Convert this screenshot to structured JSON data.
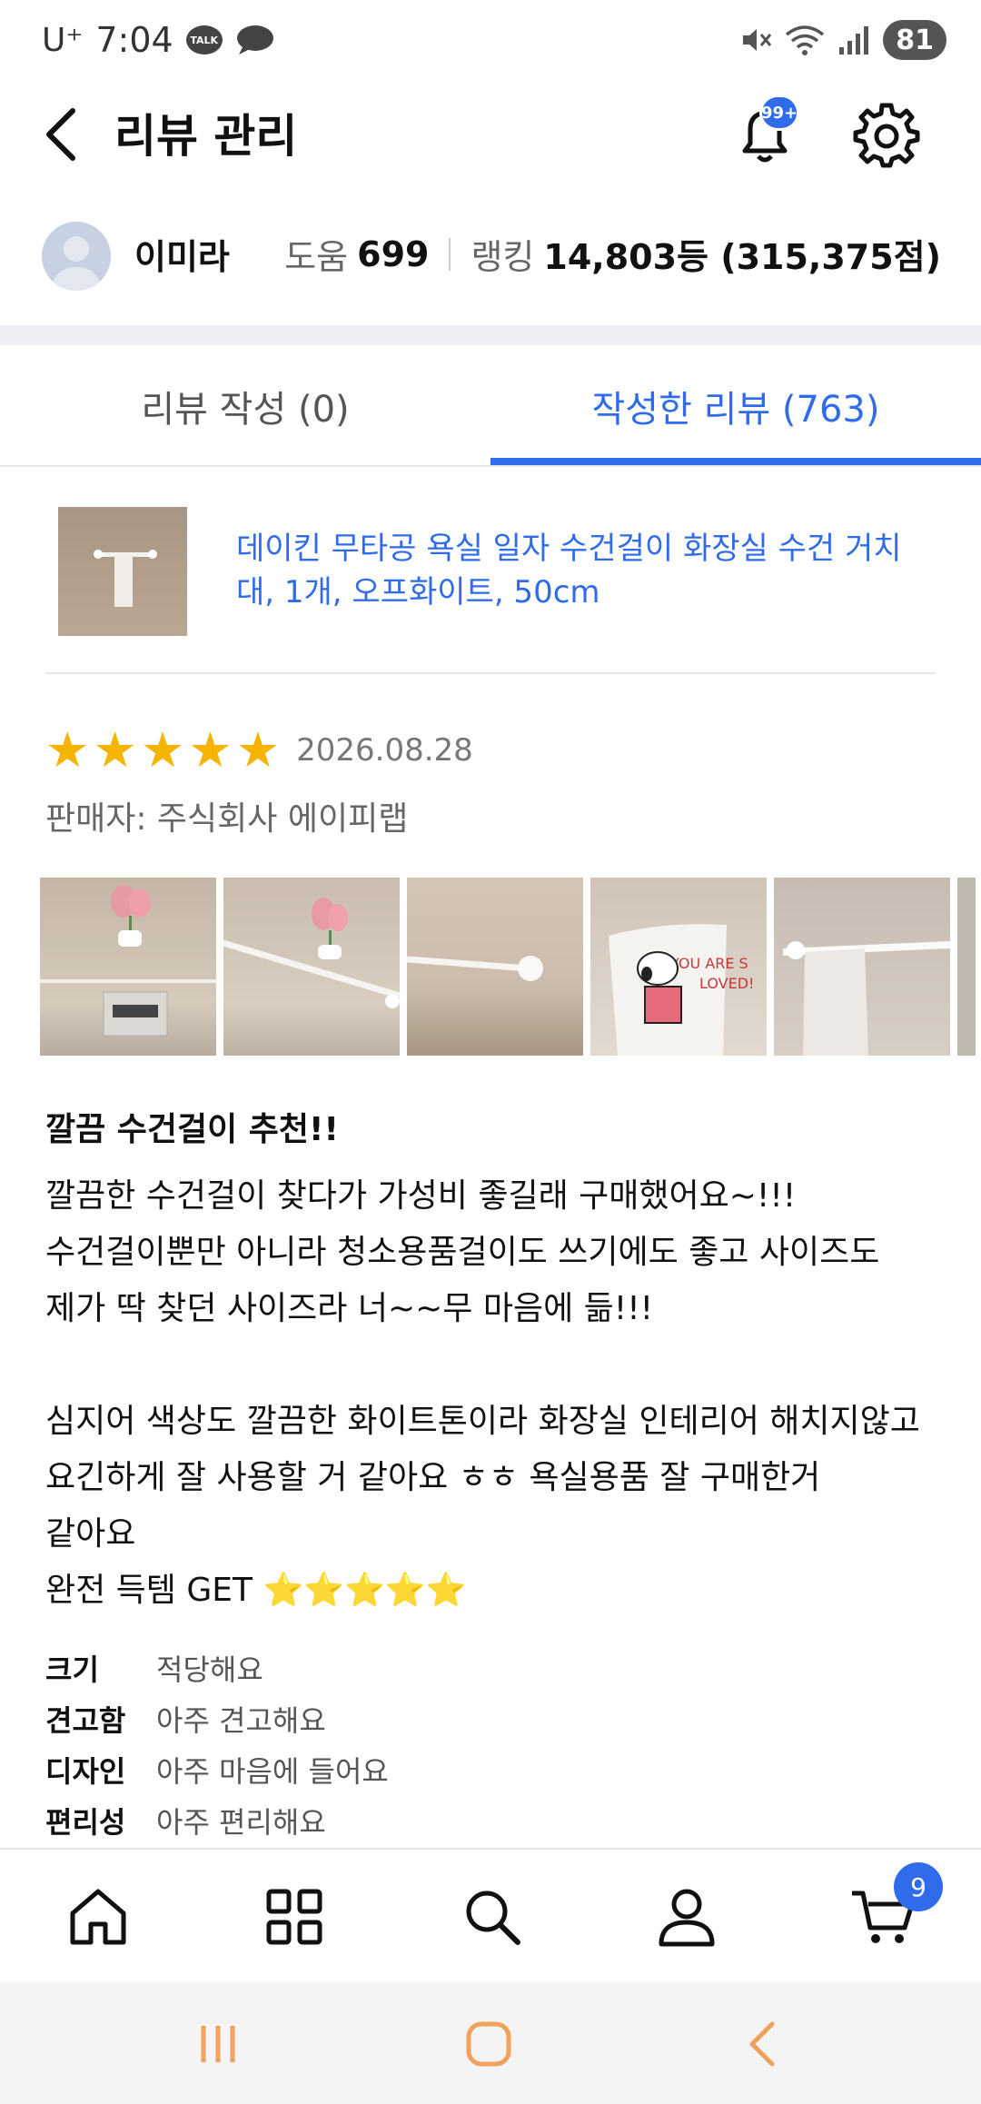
{
  "status_bar": {
    "carrier": "U⁺",
    "time": "7:04",
    "talk_icon_text": "TALK",
    "battery": "81",
    "icons": [
      "talk-icon",
      "chat-icon",
      "mute-icon",
      "wifi-icon",
      "signal-icon"
    ]
  },
  "header": {
    "title": "리뷰 관리",
    "notification_badge": "99+"
  },
  "profile": {
    "name": "이미라",
    "help_label": "도움",
    "help_value": "699",
    "ranking_label": "랭킹",
    "ranking_value": "14,803등 (315,375점)"
  },
  "tabs": [
    {
      "label": "리뷰 작성 (0)",
      "active": false
    },
    {
      "label": "작성한 리뷰 (763)",
      "active": true
    }
  ],
  "product": {
    "name": "데이킨 무타공 욕실 일자 수건걸이 화장실 수건 거치대, 1개, 오프화이트, 50cm"
  },
  "review": {
    "stars": 5,
    "date": "2026.08.28",
    "seller": "판매자: 주식회사 에이피랩",
    "photos": [
      "photo-1",
      "photo-2",
      "photo-3",
      "photo-4",
      "photo-5",
      "photo-6"
    ],
    "title": "깔끔 수건걸이 추천!!",
    "body_lines": [
      "깔끔한 수건걸이 찾다가 가성비 좋길래 구매했어요~!!!",
      "수건걸이뿐만 아니라 청소용품걸이도 쓰기에도 좋고 사이즈도",
      "제가 딱 찾던 사이즈라 너~~무 마음에 듦!!!",
      "",
      "심지어 색상도 깔끔한 화이트톤이라 화장실 인테리어 해치지않고",
      "요긴하게 잘 사용할 거 같아요 ㅎㅎ 욕실용품 잘 구매한거",
      "같아요",
      "완전 득템 GET ⭐⭐⭐⭐⭐"
    ],
    "attributes": [
      {
        "key": "크기",
        "value": "적당해요"
      },
      {
        "key": "견고함",
        "value": "아주 견고해요"
      },
      {
        "key": "디자인",
        "value": "아주 마음에 들어요"
      },
      {
        "key": "편리성",
        "value": "아주 편리해요"
      }
    ]
  },
  "bottom_nav": {
    "items": [
      "home-icon",
      "category-icon",
      "search-icon",
      "account-icon",
      "cart-icon"
    ],
    "cart_badge": "9"
  },
  "colors": {
    "accent": "#2f6bea",
    "star": "#f5b400",
    "system_nav": "#f0a15a"
  }
}
